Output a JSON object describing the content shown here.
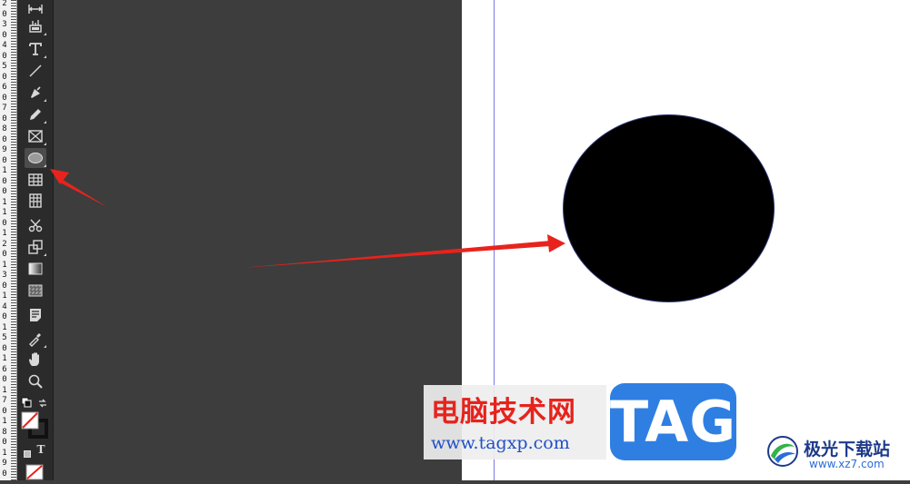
{
  "ruler": {
    "labels": [
      "2",
      "0",
      "3",
      "0",
      "4",
      "0",
      "5",
      "0",
      "6",
      "0",
      "7",
      "0",
      "8",
      "0",
      "9",
      "0",
      "1",
      "0",
      "0",
      "1",
      "1",
      "0",
      "1",
      "2",
      "0",
      "1",
      "3",
      "0",
      "1",
      "4",
      "0",
      "1",
      "5",
      "0",
      "1",
      "6",
      "0",
      "1",
      "7",
      "0",
      "1",
      "8",
      "0",
      "1",
      "9",
      "0"
    ]
  },
  "tools": [
    {
      "name": "gap-tool-icon"
    },
    {
      "name": "content-collector-icon"
    },
    {
      "name": "type-tool-icon"
    },
    {
      "name": "line-tool-icon"
    },
    {
      "name": "pen-tool-icon"
    },
    {
      "name": "pencil-tool-icon"
    },
    {
      "name": "rectangle-frame-tool-icon"
    },
    {
      "name": "ellipse-tool-icon",
      "active": true
    },
    {
      "name": "table-tool-icon"
    },
    {
      "name": "table-column-tool-icon"
    },
    {
      "name": "scissors-tool-icon"
    },
    {
      "name": "free-transform-tool-icon"
    },
    {
      "name": "gradient-swatch-tool-icon"
    },
    {
      "name": "gradient-feather-tool-icon"
    },
    {
      "name": "note-tool-icon"
    },
    {
      "name": "eyedropper-tool-icon"
    },
    {
      "name": "hand-tool-icon"
    },
    {
      "name": "zoom-tool-icon"
    }
  ],
  "toolbar_bottom": {
    "apply_text_label": "T"
  },
  "colors": {
    "panel": "#2b2b2b",
    "pasteboard": "#3d3d3d",
    "page": "#ffffff",
    "guide": "#7d78e6",
    "annotation_arrow": "#e8231d",
    "shape_fill": "#000000"
  },
  "watermark": {
    "cn_title": "电脑技术网",
    "url": "www.tagxp.com",
    "tag_text": "TAG",
    "site_name": "极光下载站",
    "site_url": "www.xz7.com"
  }
}
